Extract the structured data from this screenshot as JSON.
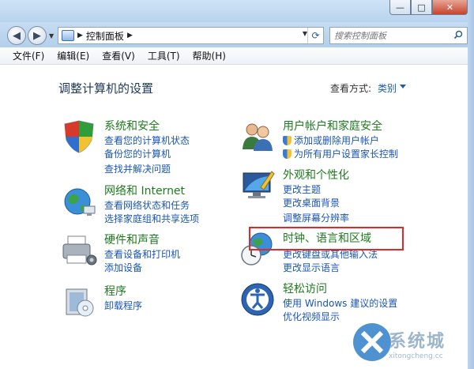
{
  "window": {
    "min_symbol": "—",
    "max_symbol": "□",
    "close_symbol": "✕"
  },
  "address": {
    "breadcrumb": "控制面板",
    "refresh_symbol": "⟳"
  },
  "search": {
    "placeholder": "搜索控制面板"
  },
  "menu": [
    "文件(F)",
    "编辑(E)",
    "查看(V)",
    "工具(T)",
    "帮助(H)"
  ],
  "header": {
    "title": "调整计算机的设置",
    "view_by_label": "查看方式:",
    "view_by_value": "类别"
  },
  "categories": [
    {
      "title": "系统和安全",
      "links": [
        "查看您的计算机状态",
        "备份您的计算机",
        "查找并解决问题"
      ]
    },
    {
      "title": "网络和 Internet",
      "links": [
        "查看网络状态和任务",
        "选择家庭组和共享选项"
      ]
    },
    {
      "title": "硬件和声音",
      "links": [
        "查看设备和打印机",
        "添加设备"
      ]
    },
    {
      "title": "程序",
      "links": [
        "卸载程序"
      ]
    },
    {
      "title": "用户帐户和家庭安全",
      "links": [
        "添加或删除用户帐户",
        "为所有用户设置家长控制"
      ]
    },
    {
      "title": "外观和个性化",
      "links": [
        "更改主题",
        "更改桌面背景",
        "调整屏幕分辨率"
      ]
    },
    {
      "title": "时钟、语言和区域",
      "links": [
        "更改键盘或其他输入法",
        "更改显示语言"
      ]
    },
    {
      "title": "轻松访问",
      "links": [
        "使用 Windows 建议的设置",
        "优化视频显示"
      ]
    }
  ],
  "watermark": {
    "text": "系统城",
    "url": "xitongcheng.cc"
  },
  "colors": {
    "title_green": "#1e7a1e",
    "link_blue": "#1a56b8",
    "highlight_red": "#e02a2a"
  }
}
